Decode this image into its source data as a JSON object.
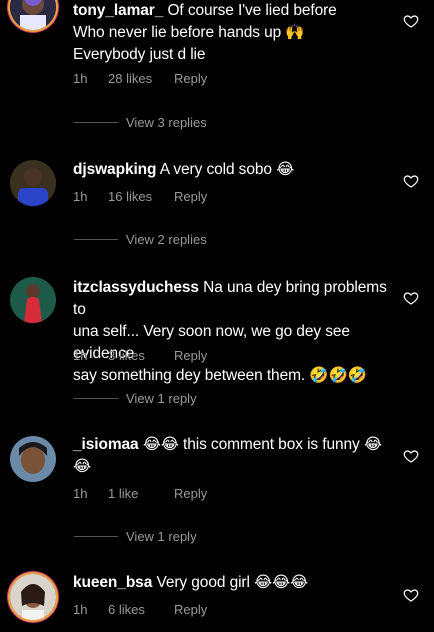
{
  "comments": [
    {
      "username": "tony_lamar_",
      "text_line1": "Of course I've lied before",
      "text_line2": "Who never lie before hands up 🙌",
      "text_line3": "Everybody just d lie",
      "time": "1h",
      "likes": "28 likes",
      "reply": "Reply",
      "view_replies": "View 3 replies"
    },
    {
      "username": "djswapking",
      "text_line1": "A very cold sobo 😂",
      "time": "1h",
      "likes": "16 likes",
      "reply": "Reply",
      "view_replies": "View 2 replies"
    },
    {
      "username": "itzclassyduchess",
      "text_line1": "Na una dey bring problems to",
      "text_line2": "una self... Very soon now, we go dey see evidence",
      "text_line3": "say something dey between them. 🤣🤣🤣",
      "time": "1h",
      "likes": "3 likes",
      "reply": "Reply",
      "view_replies": "View 1 reply"
    },
    {
      "username": "_isiomaa",
      "text_line1": "😂😂 this comment box is funny 😂",
      "text_line2": "😂",
      "time": "1h",
      "likes": "1 like",
      "reply": "Reply",
      "view_replies": "View 1 reply"
    },
    {
      "username": "kueen_bsa",
      "text_line1": "Very good girl 😂😂😂",
      "time": "1h",
      "likes": "6 likes",
      "reply": "Reply"
    }
  ],
  "colors": {
    "background": "#000000",
    "meta_text": "#9a9a9a",
    "story_ring": "#e8a33c"
  },
  "icons": [
    "heart-icon"
  ]
}
